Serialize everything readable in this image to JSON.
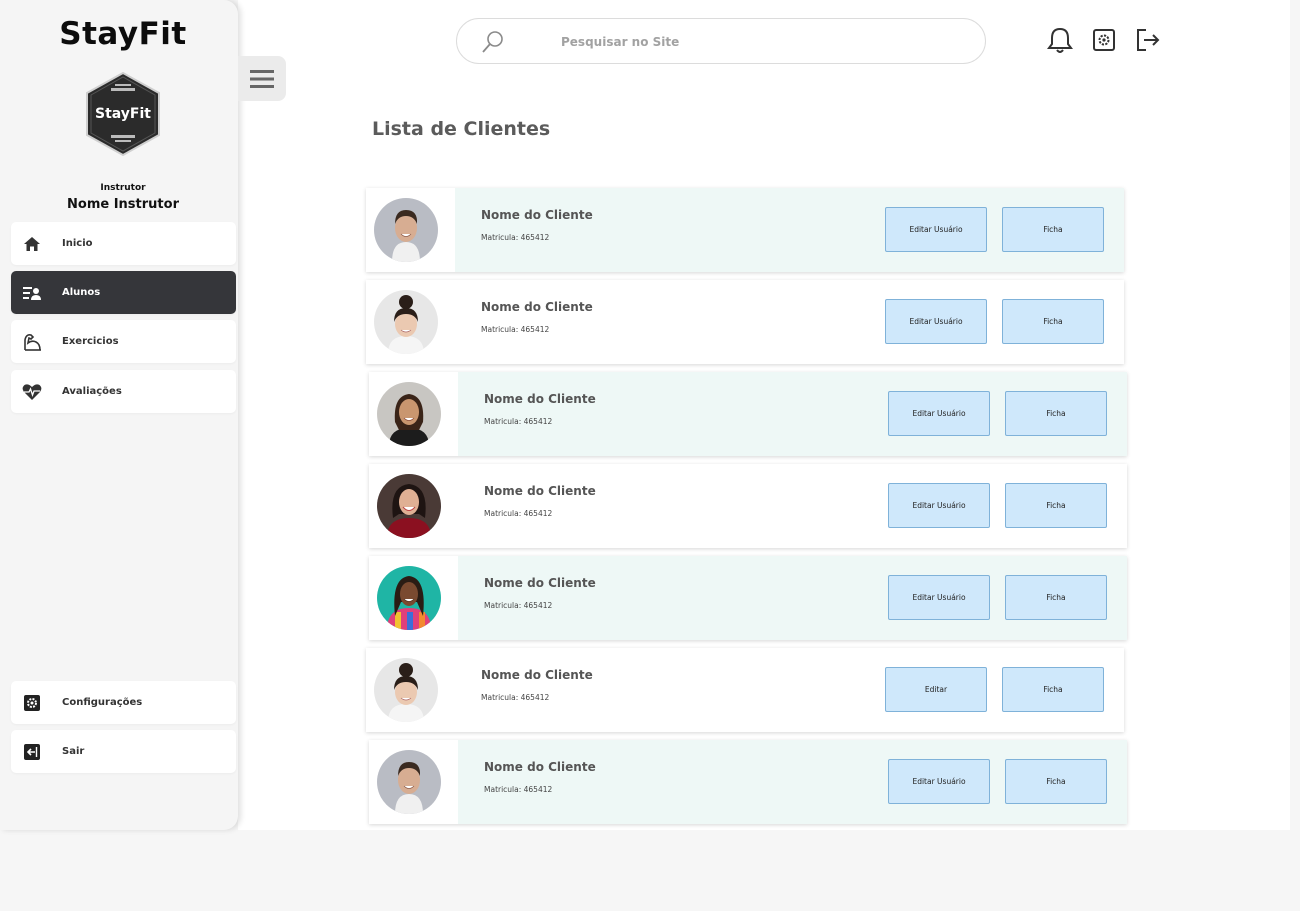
{
  "app": {
    "brand": "StayFit",
    "logo_text": "StayFit"
  },
  "user": {
    "role": "Instrutor",
    "name": "Nome Instrutor"
  },
  "sidebar": {
    "items": [
      {
        "label": "Inicio",
        "icon": "home-icon",
        "active": false
      },
      {
        "label": "Alunos",
        "icon": "students-icon",
        "active": true
      },
      {
        "label": "Exercicios",
        "icon": "arm-icon",
        "active": false
      },
      {
        "label": "Avaliações",
        "icon": "heart-pulse-icon",
        "active": false
      }
    ],
    "bottom_items": [
      {
        "label": "Configurações",
        "icon": "settings-icon"
      },
      {
        "label": "Sair",
        "icon": "exit-icon"
      }
    ]
  },
  "header": {
    "search_placeholder": "Pesquisar no Site",
    "icons": [
      "bell-icon",
      "settings-icon",
      "logout-icon"
    ]
  },
  "page": {
    "title": "Lista de Clientes"
  },
  "clients": [
    {
      "name": "Nome do Cliente",
      "matricula": "Matricula: 465412",
      "edit_label": "Editar Usuário",
      "ficha_label": "Ficha",
      "tinted": true
    },
    {
      "name": "Nome do Cliente",
      "matricula": "Matricula: 465412",
      "edit_label": "Editar Usuário",
      "ficha_label": "Ficha",
      "tinted": false
    },
    {
      "name": "Nome do Cliente",
      "matricula": "Matricula: 465412",
      "edit_label": "Editar Usuário",
      "ficha_label": "Ficha",
      "tinted": true
    },
    {
      "name": "Nome do Cliente",
      "matricula": "Matricula: 465412",
      "edit_label": "Editar Usuário",
      "ficha_label": "Ficha",
      "tinted": false
    },
    {
      "name": "Nome do Cliente",
      "matricula": "Matricula: 465412",
      "edit_label": "Editar Usuário",
      "ficha_label": "Ficha",
      "tinted": true
    },
    {
      "name": "Nome do Cliente",
      "matricula": "Matricula: 465412",
      "edit_label": "Editar",
      "ficha_label": "Ficha",
      "tinted": false
    },
    {
      "name": "Nome do Cliente",
      "matricula": "Matricula: 465412",
      "edit_label": "Editar Usuário",
      "ficha_label": "Ficha",
      "tinted": true
    }
  ],
  "colors": {
    "accent_dark": "#35363a",
    "button_fill": "#cfe8fb",
    "button_border": "#7fb2d9",
    "row_tint": "#eef8f6"
  }
}
